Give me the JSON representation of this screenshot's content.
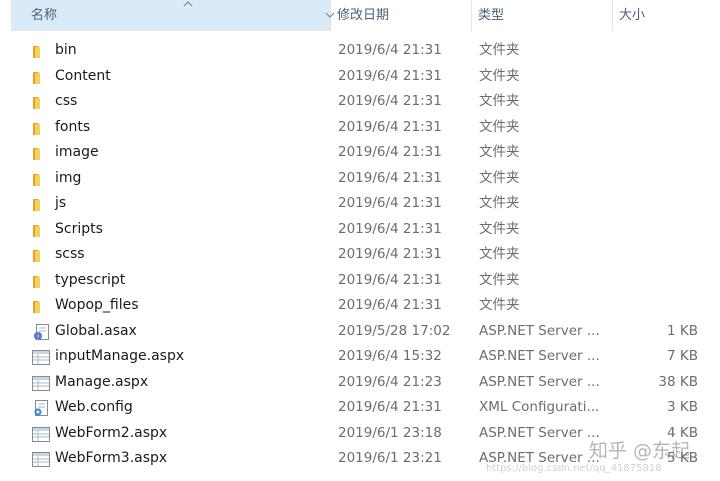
{
  "header": {
    "name_label": "名称",
    "date_label": "修改日期",
    "type_label": "类型",
    "size_label": "大小"
  },
  "files": [
    {
      "name": "bin",
      "date": "2019/6/4 21:31",
      "type": "文件夹",
      "size": "",
      "icon": "folder-icon"
    },
    {
      "name": "Content",
      "date": "2019/6/4 21:31",
      "type": "文件夹",
      "size": "",
      "icon": "folder-icon"
    },
    {
      "name": "css",
      "date": "2019/6/4 21:31",
      "type": "文件夹",
      "size": "",
      "icon": "folder-icon"
    },
    {
      "name": "fonts",
      "date": "2019/6/4 21:31",
      "type": "文件夹",
      "size": "",
      "icon": "folder-icon"
    },
    {
      "name": "image",
      "date": "2019/6/4 21:31",
      "type": "文件夹",
      "size": "",
      "icon": "folder-icon"
    },
    {
      "name": "img",
      "date": "2019/6/4 21:31",
      "type": "文件夹",
      "size": "",
      "icon": "folder-icon"
    },
    {
      "name": "js",
      "date": "2019/6/4 21:31",
      "type": "文件夹",
      "size": "",
      "icon": "folder-icon"
    },
    {
      "name": "Scripts",
      "date": "2019/6/4 21:31",
      "type": "文件夹",
      "size": "",
      "icon": "folder-icon"
    },
    {
      "name": "scss",
      "date": "2019/6/4 21:31",
      "type": "文件夹",
      "size": "",
      "icon": "folder-icon"
    },
    {
      "name": "typescript",
      "date": "2019/6/4 21:31",
      "type": "文件夹",
      "size": "",
      "icon": "folder-icon"
    },
    {
      "name": "Wopop_files",
      "date": "2019/6/4 21:31",
      "type": "文件夹",
      "size": "",
      "icon": "folder-icon"
    },
    {
      "name": "Global.asax",
      "date": "2019/5/28 17:02",
      "type": "ASP.NET Server ...",
      "size": "1 KB",
      "icon": "global-asax-icon"
    },
    {
      "name": "inputManage.aspx",
      "date": "2019/6/4 15:32",
      "type": "ASP.NET Server ...",
      "size": "7 KB",
      "icon": "aspx-file-icon"
    },
    {
      "name": "Manage.aspx",
      "date": "2019/6/4 21:23",
      "type": "ASP.NET Server ...",
      "size": "38 KB",
      "icon": "aspx-file-icon"
    },
    {
      "name": "Web.config",
      "date": "2019/6/4 21:31",
      "type": "XML Configurati...",
      "size": "3 KB",
      "icon": "config-file-icon"
    },
    {
      "name": "WebForm2.aspx",
      "date": "2019/6/1 23:18",
      "type": "ASP.NET Server ...",
      "size": "4 KB",
      "icon": "aspx-file-icon"
    },
    {
      "name": "WebForm3.aspx",
      "date": "2019/6/1 23:21",
      "type": "ASP.NET Server ...",
      "size": "5 KB",
      "icon": "aspx-file-icon"
    }
  ],
  "watermark": {
    "text": "知乎 @东起",
    "sub": "https://blog.csdn.net/qq_41875818"
  },
  "colors": {
    "folder": "#f2c14e",
    "header_active_bg": "#d9ebf9",
    "header_text": "#4c607a"
  }
}
